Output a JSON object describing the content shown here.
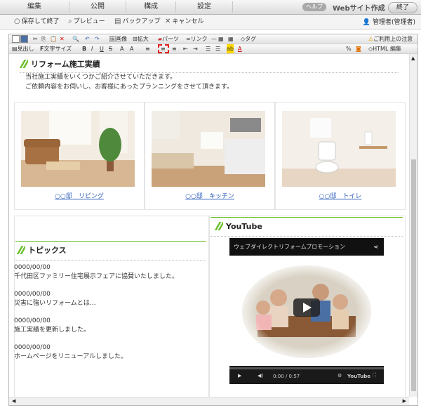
{
  "top_nav": {
    "tabs": [
      "編集",
      "公開",
      "構成",
      "設定"
    ],
    "help": "ヘルプ",
    "website_label": "Webサイト作成",
    "end": "終了"
  },
  "action_bar": {
    "save_exit": "保存して終了",
    "preview": "プレビュー",
    "backup": "バックアップ",
    "cancel": "キャンセル",
    "user": "管理者(管理者)"
  },
  "toolbar": {
    "image": "画像",
    "zoom": "拡大",
    "parts": "パーツ",
    "link": "リンク",
    "tag": "タグ",
    "notice": "ご利用上の注意",
    "heading": "見出し",
    "font_size": "文字サイズ",
    "bold": "B",
    "italic": "I",
    "underline": "U",
    "html_edit": "HTML 編集"
  },
  "colors": {
    "accent_green": "#6cbf2d",
    "link_blue": "#2a5cb8",
    "highlight_red": "#e02020"
  },
  "reform": {
    "title": "リフォーム施工実績",
    "intro": [
      "当社施工実績をいくつかご紹介させていただきます。",
      "ご依頼内容をお伺いし、お客様にあったプランニングをさせて頂きます。"
    ],
    "items": [
      {
        "caption": "○○邸　リビング",
        "icon": "living-room-photo"
      },
      {
        "caption": "○○邸　キッチン",
        "icon": "kitchen-photo"
      },
      {
        "caption": "○○邸　トイレ",
        "icon": "toilet-photo"
      }
    ]
  },
  "topics": {
    "title": "トピックス",
    "news": [
      {
        "date": "0000/00/00",
        "text": "千代田区ファミリー住宅展示フェアに協賛いたしました。"
      },
      {
        "date": "0000/00/00",
        "text": "災害に強いリフォームとは…"
      },
      {
        "date": "0000/00/00",
        "text": "施工実績を更新しました。"
      },
      {
        "date": "0000/00/00",
        "text": "ホームページをリニューアルしました。"
      }
    ]
  },
  "youtube": {
    "title": "YouTube",
    "video_title": "ウェブダイレクトリフォームプロモーション",
    "time": "0:00 / 0:57",
    "logo": "YouTube"
  }
}
